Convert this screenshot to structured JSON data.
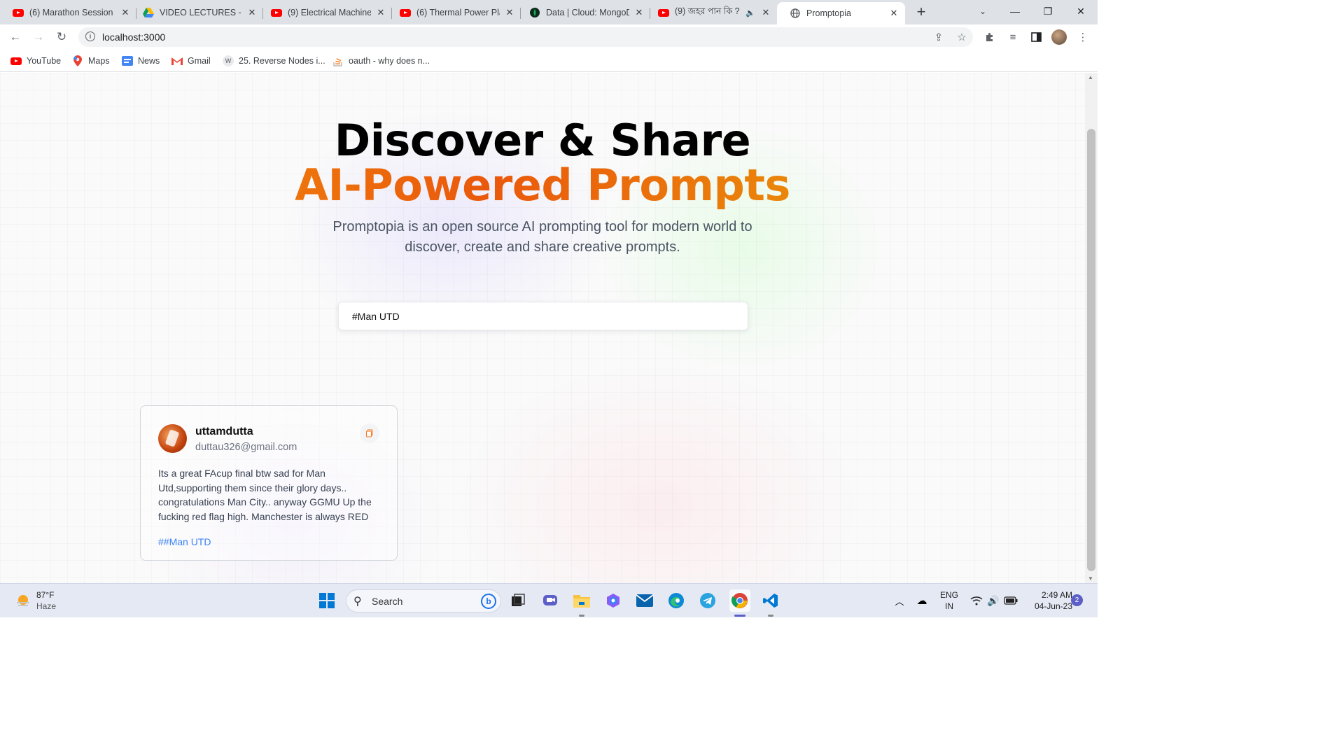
{
  "browser": {
    "tabs": [
      {
        "label": "(6) Marathon Session",
        "icon": "youtube-icon"
      },
      {
        "label": "VIDEO LECTURES - Go",
        "icon": "google-drive-icon"
      },
      {
        "label": "(9) Electrical Machine",
        "icon": "youtube-icon"
      },
      {
        "label": "(6) Thermal Power Pla",
        "icon": "youtube-icon"
      },
      {
        "label": "Data | Cloud: MongoD",
        "icon": "mongodb-icon"
      },
      {
        "label": "(9) জহর পান কি ?",
        "icon": "youtube-icon"
      },
      {
        "label": "Promptopia",
        "icon": "globe-icon"
      }
    ],
    "url": "localhost:3000",
    "bookmarks": [
      {
        "label": "YouTube",
        "icon": "youtube-icon"
      },
      {
        "label": "Maps",
        "icon": "maps-icon"
      },
      {
        "label": "News",
        "icon": "news-icon"
      },
      {
        "label": "Gmail",
        "icon": "gmail-icon"
      },
      {
        "label": "25. Reverse Nodes i...",
        "icon": "wiki-icon"
      },
      {
        "label": "oauth - why does n...",
        "icon": "stackoverflow-icon"
      }
    ]
  },
  "hero": {
    "title_line1": "Discover & Share",
    "title_line2": "AI-Powered Prompts",
    "description": "Promptopia is an open source AI prompting tool for modern world to discover, create and share creative prompts."
  },
  "search": {
    "value": "#Man UTD"
  },
  "prompt_card": {
    "username": "uttamdutta",
    "email": "duttau326@gmail.com",
    "text": "Its a great FAcup final btw sad for Man Utd,supporting them since their glory days.. congratulations Man City.. anyway GGMU Up the fucking red flag high. Manchester is always RED",
    "tag": "##Man UTD"
  },
  "taskbar": {
    "weather_temp": "87°F",
    "weather_desc": "Haze",
    "search_label": "Search",
    "lang_1": "ENG",
    "lang_2": "IN",
    "time": "2:49 AM",
    "date": "04-Jun-23",
    "notification_count": "2"
  }
}
